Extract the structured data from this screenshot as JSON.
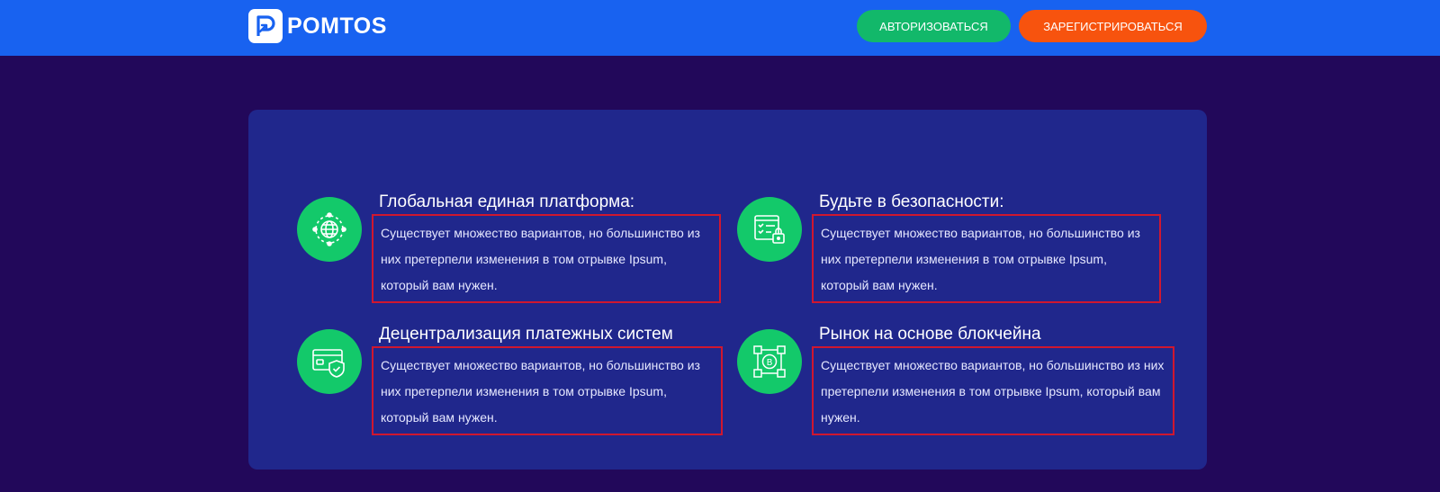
{
  "header": {
    "logo_text": "POMTOS",
    "login_label": "АВТОРИЗОВАТЬСЯ",
    "register_label": "ЗАРЕГИСТРИРОВАТЬСЯ"
  },
  "colors": {
    "header_bg": "#1862f0",
    "page_bg": "#22085a",
    "panel_bg": "#20278c",
    "icon_circle": "#13c96a",
    "login_button": "#12b86a",
    "register_button": "#f7530e",
    "highlight_border": "#d0172f"
  },
  "features": [
    {
      "icon": "globe-network-icon",
      "title": "Глобальная единая платформа:",
      "description": "Существует множество вариантов, но большинство из них претерпели изменения в том отрывке Ipsum, который вам нужен."
    },
    {
      "icon": "secure-checklist-lock-icon",
      "title": "Будьте в безопасности:",
      "description": "Существует множество вариантов, но большинство из них претерпели изменения в том отрывке Ipsum, который вам нужен."
    },
    {
      "icon": "card-shield-icon",
      "title": "Децентрализация платежных систем",
      "description": "Существует множество вариантов, но большинство из них претерпели изменения в том отрывке Ipsum, который вам нужен."
    },
    {
      "icon": "blockchain-bitcoin-icon",
      "title": "Рынок на основе блокчейна",
      "description": "Существует множество вариантов, но большинство из них претерпели изменения в том отрывке Ipsum, который вам нужен."
    }
  ]
}
